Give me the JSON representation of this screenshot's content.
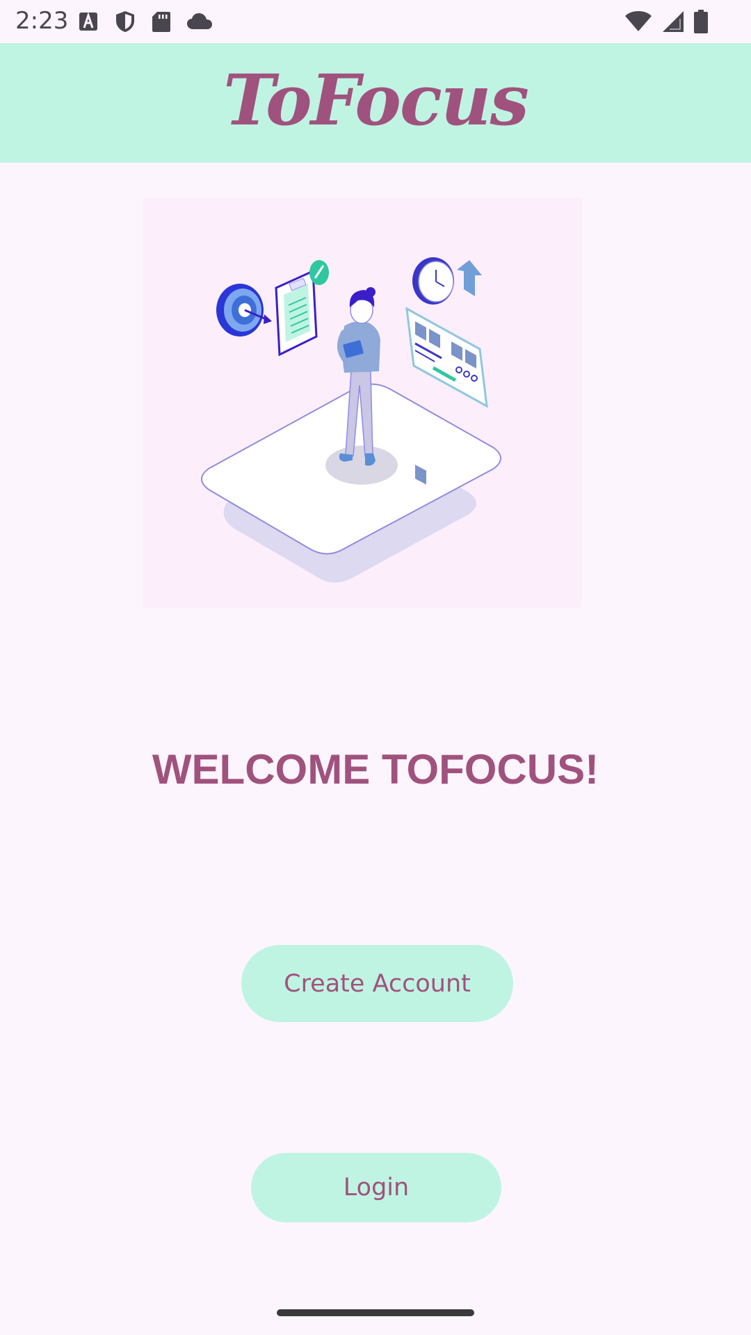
{
  "status_bar": {
    "time": "2:23",
    "left_icons": [
      "font-a-icon",
      "shield-icon",
      "sd-card-icon",
      "cloud-icon"
    ],
    "right_icons": [
      "wifi-icon",
      "cellular-signal-icon",
      "battery-icon"
    ]
  },
  "app_bar": {
    "title": "ToFocus"
  },
  "main": {
    "welcome_text": "WELCOME TOFOCUS!",
    "create_account_label": "Create Account",
    "login_label": "Login"
  },
  "colors": {
    "accent": "#a0527e",
    "button_bg": "#c0f4e2",
    "background": "#fdf5fd",
    "illustration_bg": "#fdeefc"
  }
}
